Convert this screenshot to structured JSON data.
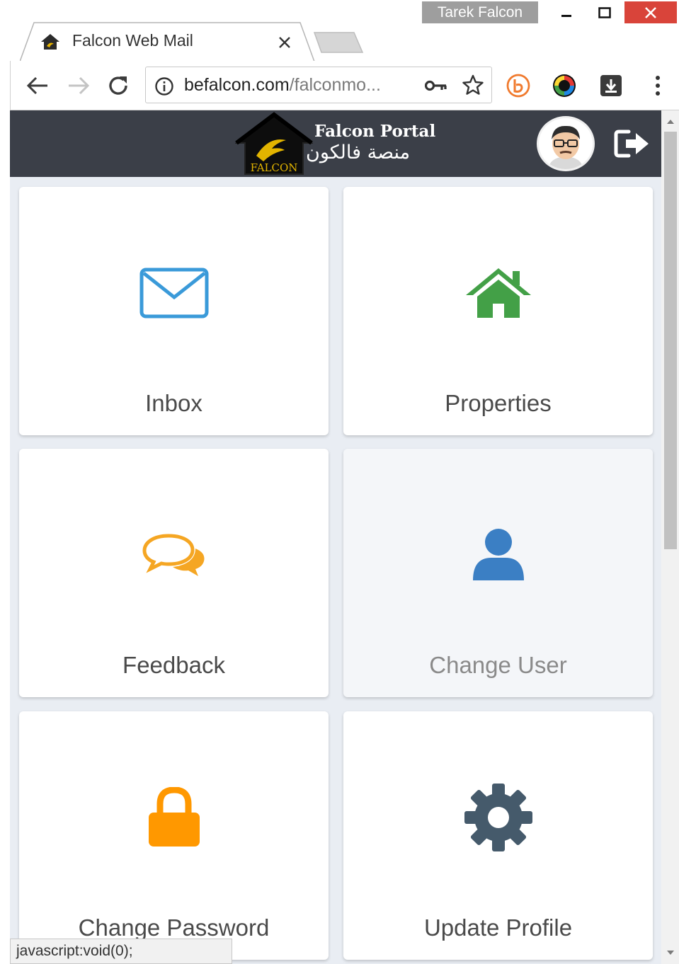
{
  "window": {
    "profile_name": "Tarek Falcon",
    "minimize_icon": "minimize-icon",
    "maximize_icon": "maximize-icon",
    "close_icon": "close-icon",
    "close_color": "#d9443a"
  },
  "tab": {
    "title": "Falcon Web Mail",
    "close_icon": "close-icon"
  },
  "toolbar": {
    "back_icon": "arrow-left-icon",
    "forward_icon": "arrow-right-icon",
    "reload_icon": "reload-icon",
    "url_domain": "befalcon.com",
    "url_path": "/falconmo...",
    "info_icon": "info-icon",
    "key_icon": "key-icon",
    "bookmark_icon": "star-icon",
    "extensions": [
      "extension-orange-icon",
      "extension-colorwheel-icon",
      "extension-download-icon"
    ],
    "menu_icon": "kebab-menu-icon"
  },
  "header": {
    "logo_text": "FALCON",
    "title_en": "Falcon Portal",
    "title_ar": "منصة فالكون",
    "background": "#3b3f48"
  },
  "tiles": [
    {
      "label": "Inbox",
      "icon": "envelope-icon",
      "color": "#3a9ad9"
    },
    {
      "label": "Properties",
      "icon": "house-icon",
      "color": "#43a047"
    },
    {
      "label": "Feedback",
      "icon": "chat-bubbles-icon",
      "color": "#f5a623"
    },
    {
      "label": "Change User",
      "icon": "user-icon",
      "color": "#3b7fc4"
    },
    {
      "label": "Change Password",
      "icon": "lock-icon",
      "color": "#ff9800"
    },
    {
      "label": "Update Profile",
      "icon": "gear-icon",
      "color": "#455a6b"
    }
  ],
  "status_bar": {
    "text": "javascript:void(0);"
  }
}
